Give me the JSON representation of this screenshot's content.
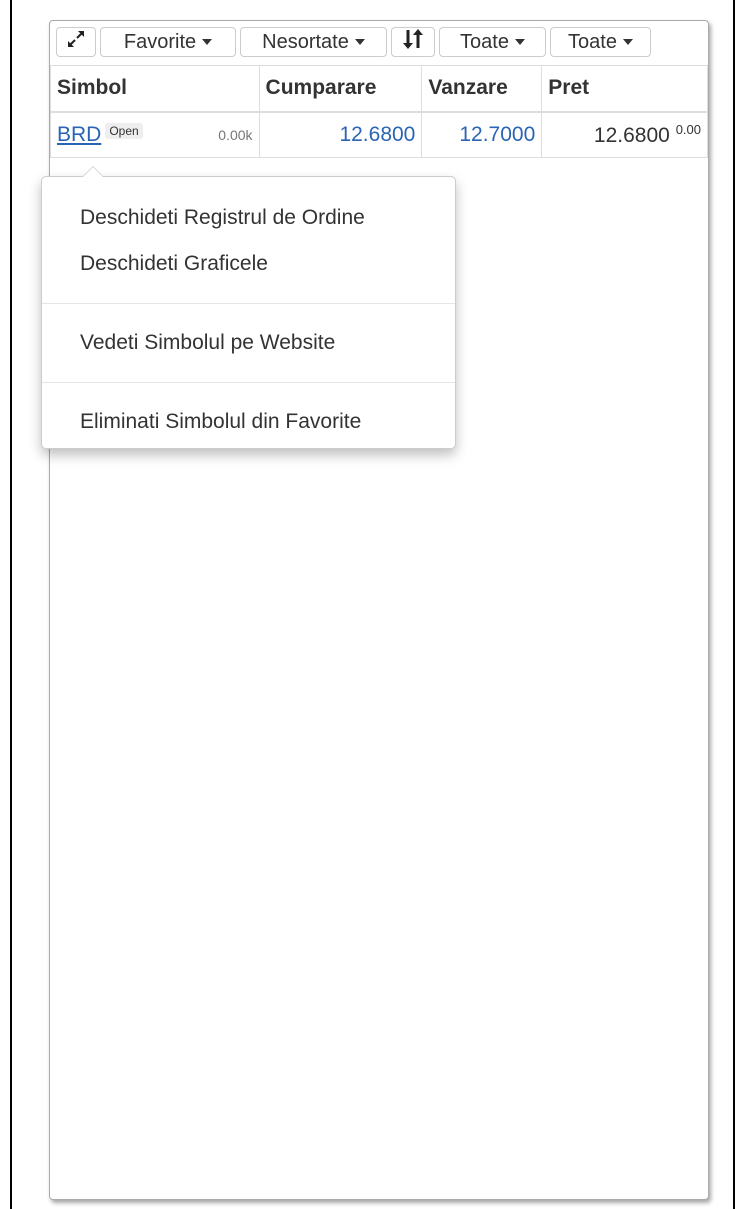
{
  "toolbar": {
    "favorites_label": "Favorite",
    "sort_label": "Nesortate",
    "filter1_label": "Toate",
    "filter2_label": "Toate"
  },
  "table": {
    "columns": [
      "Simbol",
      "Cumparare",
      "Vanzare",
      "Pret"
    ],
    "rows": [
      {
        "symbol": "BRD",
        "status": "Open",
        "volume": "0.00k",
        "bid": "12.6800",
        "ask": "12.7000",
        "price": "12.6800",
        "change": "0.00"
      }
    ]
  },
  "context_menu": {
    "open_order_book": "Deschideti Registrul de Ordine",
    "open_charts": "Deschideti Graficele",
    "view_on_website": "Vedeti Simbolul pe Website",
    "remove_from_favorites": "Eliminati Simbolul din Favorite"
  }
}
